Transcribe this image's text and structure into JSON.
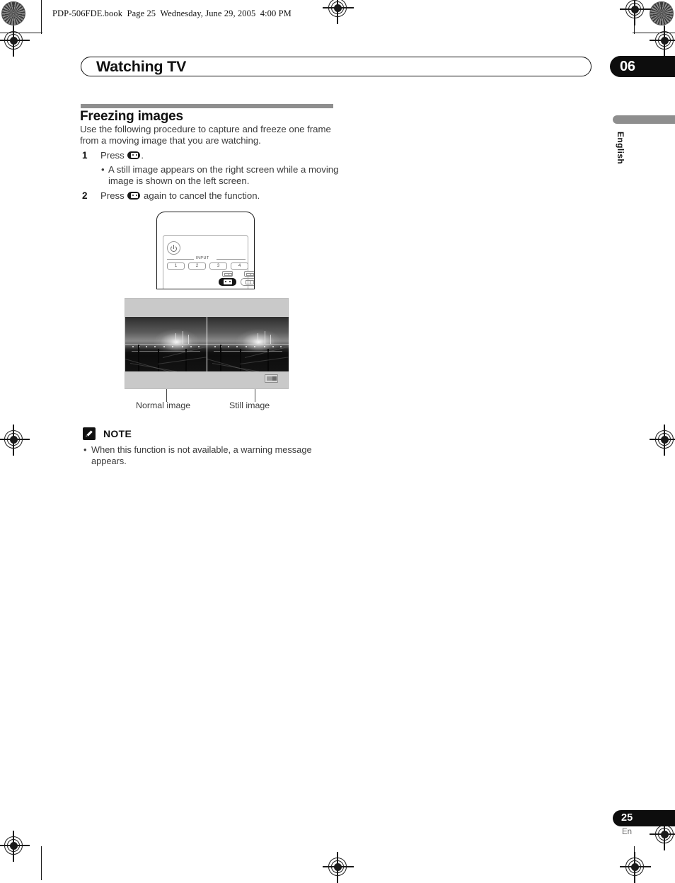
{
  "document": {
    "file_stamp": "PDP-506FDE.book  Page 25  Wednesday, June 29, 2005  4:00 PM",
    "chapter_title": "Watching TV",
    "chapter_number": "06",
    "language_tab": "English",
    "page_number": "25",
    "page_language_code": "En"
  },
  "section": {
    "heading": "Freezing images",
    "intro": "Use the following procedure to capture and freeze one frame from a moving image that you are watching.",
    "steps": [
      {
        "number": "1",
        "text_before": "Press ",
        "text_after": ".",
        "sub_bullets": [
          "A still image appears on the right screen while a moving image is shown on the left screen."
        ]
      },
      {
        "number": "2",
        "text_before": "Press ",
        "text_after": " again to cancel the function.",
        "sub_bullets": []
      }
    ]
  },
  "remote": {
    "input_label": "INPUT",
    "number_buttons": [
      "1",
      "2",
      "3",
      "4"
    ],
    "power_icon": "power-icon",
    "freeze_button_icon": "freeze-split-screen-icon",
    "screen_size_button_icon": "screen-size-icon"
  },
  "illustration": {
    "caption_left": "Normal image",
    "caption_right": "Still image",
    "osd_icon": "split-screen-indicator-icon"
  },
  "note": {
    "icon": "pencil-note-icon",
    "title": "NOTE",
    "bullet_char": "•",
    "items": [
      "When this function is not available, a warning message appears."
    ]
  },
  "colors": {
    "badge_black": "#0d0d0d",
    "rule_gray": "#8e8e8e",
    "body_text": "#3b3b3b",
    "heading_text": "#111111"
  }
}
